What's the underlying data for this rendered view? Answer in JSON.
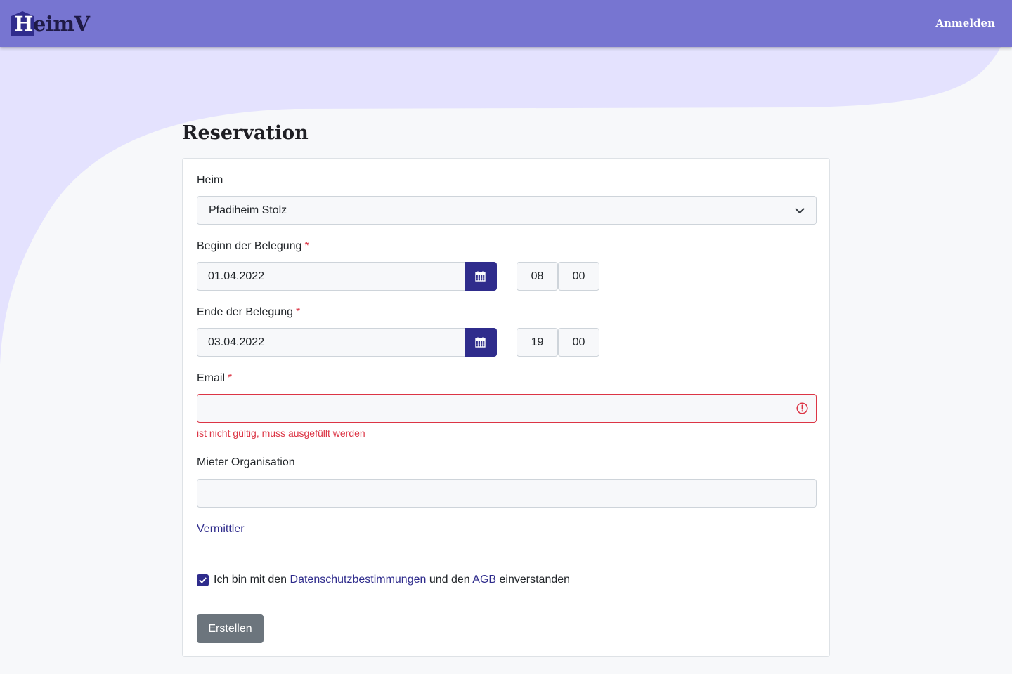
{
  "app": {
    "logo_first": "H",
    "logo_rest": "eimV",
    "login_label": "Anmelden"
  },
  "page": {
    "title": "Reservation"
  },
  "form": {
    "home_label": "Heim",
    "home_value": "Pfadiheim Stolz",
    "begin": {
      "label": "Beginn der Belegung",
      "required_mark": "*",
      "date": "01.04.2022",
      "hour": "08",
      "minute": "00"
    },
    "end": {
      "label": "Ende der Belegung",
      "required_mark": "*",
      "date": "03.04.2022",
      "hour": "19",
      "minute": "00"
    },
    "email": {
      "label": "Email",
      "required_mark": "*",
      "value": "",
      "error": "ist nicht gültig, muss ausgefüllt werden"
    },
    "organisation": {
      "label": "Mieter Organisation",
      "value": ""
    },
    "intermediary_link": "Vermittler",
    "consent": {
      "checked": true,
      "prefix": "Ich bin mit den",
      "privacy_link": "Datenschutzbestimmungen",
      "middle": "und den",
      "terms_link": "AGB",
      "suffix": "einverstanden"
    },
    "submit_label": "Erstellen"
  },
  "colors": {
    "navbar": "#7775d1",
    "wave": "#e4e2fe",
    "primary": "#2f2c8c",
    "danger": "#dc3545",
    "secondary_button": "#6c757d"
  }
}
